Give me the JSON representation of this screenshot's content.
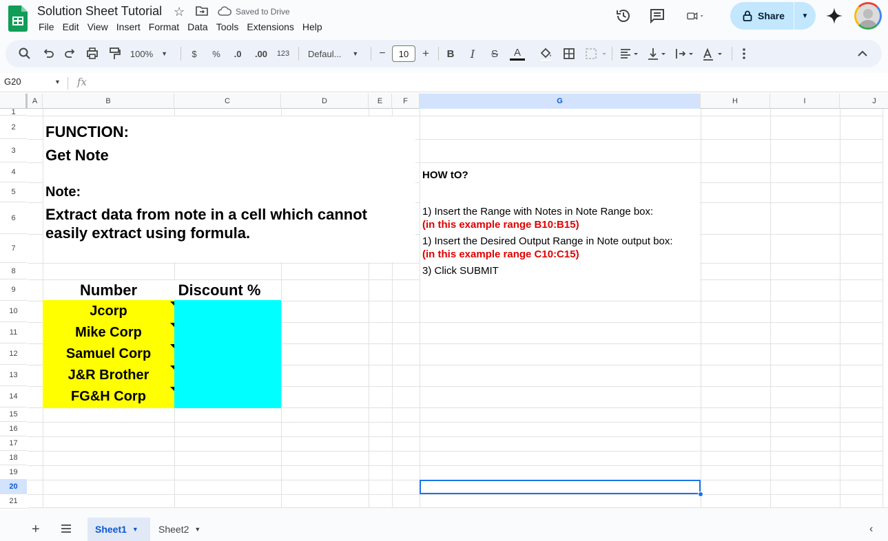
{
  "app": {
    "title": "Solution Sheet Tutorial",
    "saved_status": "Saved to Drive",
    "menu": [
      "File",
      "Edit",
      "View",
      "Insert",
      "Format",
      "Data",
      "Tools",
      "Extensions",
      "Help"
    ],
    "share_label": "Share"
  },
  "toolbar": {
    "zoom": "100%",
    "currency": "$",
    "percent": "%",
    "decrease_decimal": ".0",
    "increase_decimal": ".00",
    "number_format": "123",
    "font": "Defaul...",
    "font_size": "10",
    "minus": "−",
    "plus": "+",
    "bold": "B",
    "italic": "I",
    "strike": "S",
    "text_color": "A"
  },
  "formula_bar": {
    "name_box": "G20",
    "fx": "fx"
  },
  "grid": {
    "columns": [
      "A",
      "B",
      "C",
      "D",
      "E",
      "F",
      "G",
      "H",
      "I",
      "J"
    ],
    "selected_column": "G",
    "rows": [
      "1",
      "2",
      "3",
      "4",
      "5",
      "6",
      "7",
      "8",
      "9",
      "10",
      "11",
      "12",
      "13",
      "14",
      "15",
      "16",
      "17",
      "18",
      "19",
      "20",
      "21"
    ],
    "selected_row": "20"
  },
  "content": {
    "function_label": "FUNCTION:",
    "function_name": "Get Note",
    "note_label": "Note:",
    "note_line1": "Extract data from note in a cell which cannot",
    "note_line2": "easily extract using formula.",
    "header_number": "Number",
    "header_discount": "Discount %",
    "companies": [
      "Jcorp",
      "Mike Corp",
      "Samuel Corp",
      "J&R Brother",
      "FG&H Corp"
    ],
    "howto_title": "HOW tO?",
    "step1": "1) Insert the Range with Notes in Note Range box:",
    "step1_example": "(in this example range B10:B15)",
    "step2": "1) Insert the Desired Output Range in Note output box:",
    "step2_example": "(in this example range C10:C15)",
    "step3": "3) Click SUBMIT"
  },
  "sheets": {
    "tabs": [
      "Sheet1",
      "Sheet2"
    ],
    "active": "Sheet1"
  },
  "colors": {
    "yellow_fill": "#ffff00",
    "cyan_fill": "#00ffff",
    "example_red": "#e00000",
    "share_bg": "#c2e7ff"
  }
}
